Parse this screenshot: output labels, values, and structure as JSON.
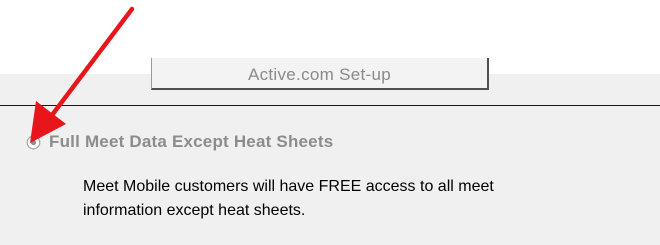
{
  "setup_button": {
    "label": "Active.com Set-up"
  },
  "option": {
    "label": "Full Meet Data Except Heat Sheets",
    "selected": true,
    "enabled": false,
    "icon": "radio-selected-icon"
  },
  "description": {
    "line1": "Meet Mobile customers will have FREE access to all meet",
    "line2": "information except heat sheets."
  },
  "annotation": {
    "icon": "red-arrow-icon",
    "color": "#e8151b"
  }
}
